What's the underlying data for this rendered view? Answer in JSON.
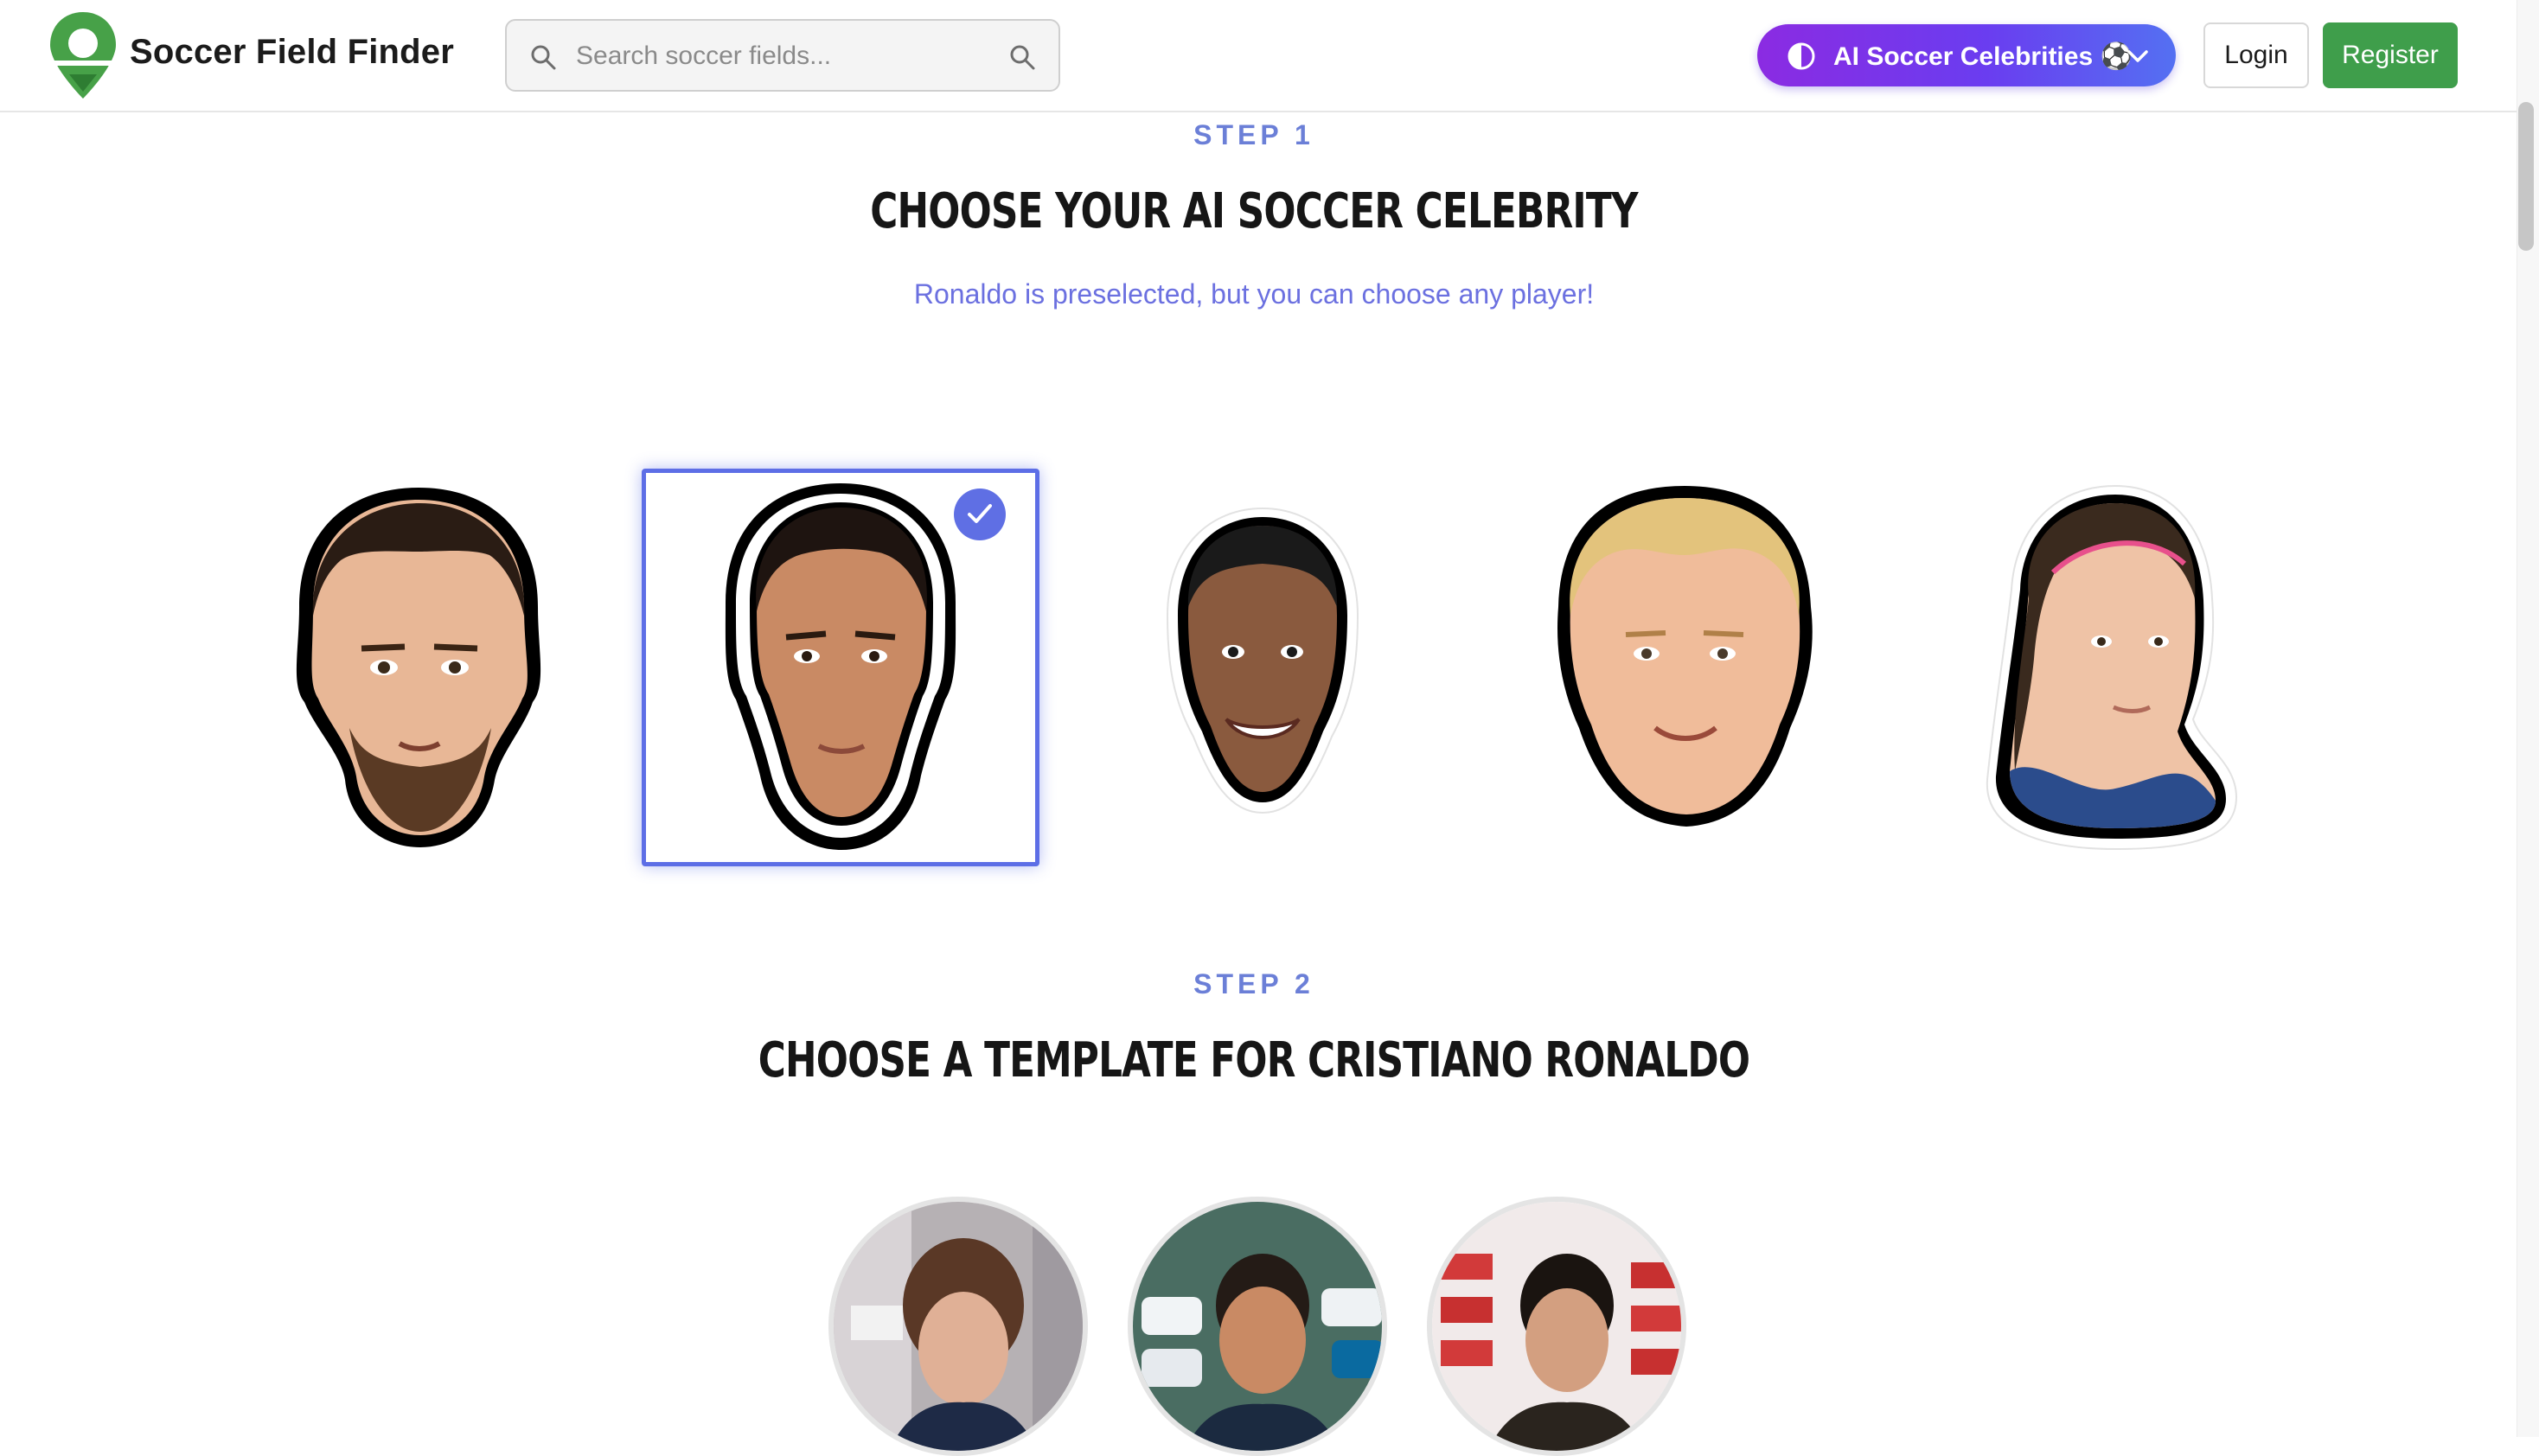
{
  "header": {
    "brand": "Soccer Field Finder",
    "search_placeholder": "Search soccer fields...",
    "celebrities_button": "AI Soccer Celebrities ⚽",
    "login": "Login",
    "register": "Register"
  },
  "step1": {
    "label": "STEP 1",
    "title": "CHOOSE YOUR AI SOCCER CELEBRITY",
    "subtitle": "Ronaldo is preselected, but you can choose any player!"
  },
  "step2": {
    "label": "STEP 2",
    "title": "CHOOSE A TEMPLATE FOR CRISTIANO RONALDO"
  },
  "colors": {
    "accent": "#5d6ee6",
    "brand_green": "#3f9e4b",
    "gradient_start": "#8b2be2",
    "gradient_end": "#5470f2"
  }
}
